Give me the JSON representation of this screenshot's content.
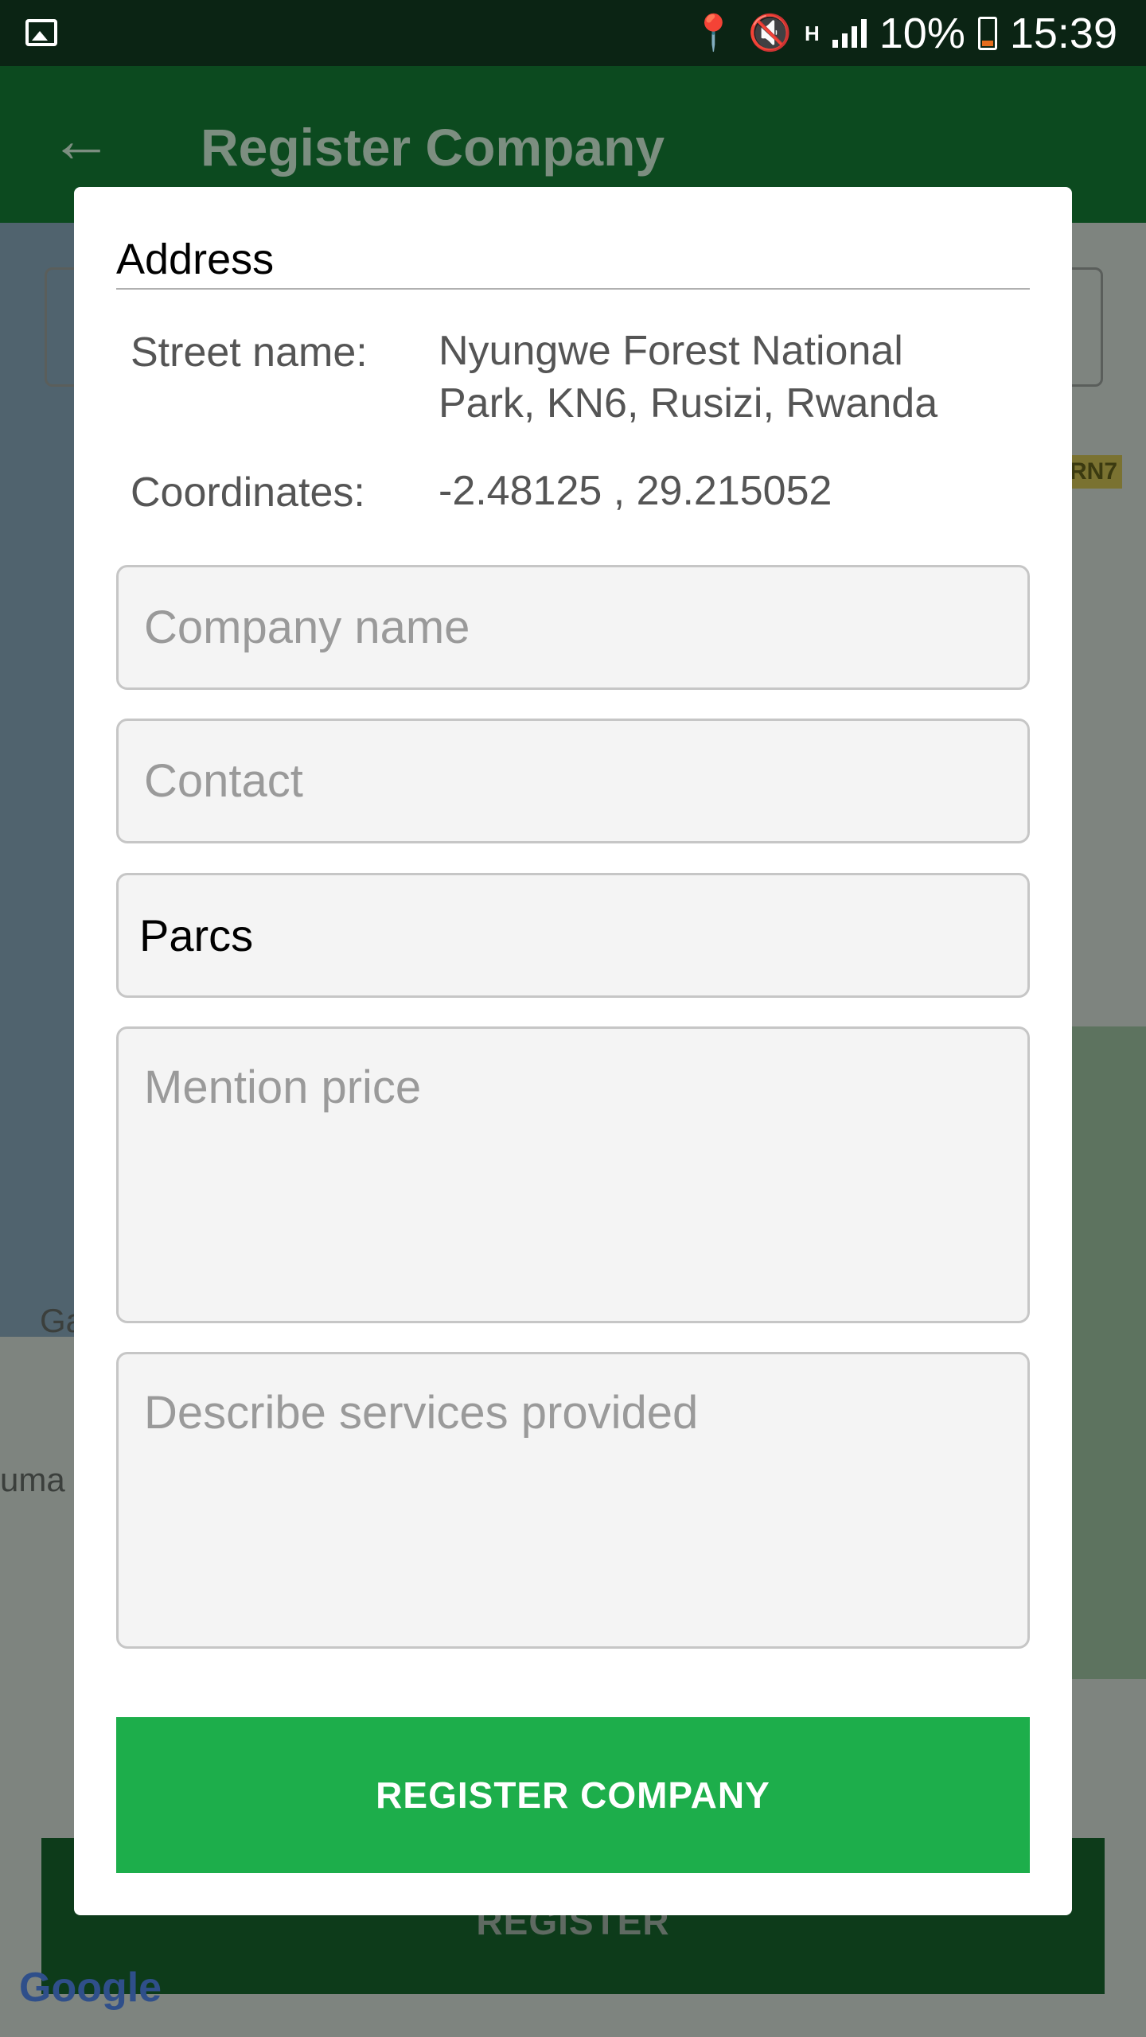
{
  "status_bar": {
    "battery": "10%",
    "time": "15:39",
    "network_type": "H",
    "icons": [
      "image-icon",
      "location-pin-icon",
      "vibrate-icon",
      "signal-icon",
      "battery-icon"
    ]
  },
  "app_bar": {
    "title": "Register Company",
    "back_icon": "arrow-back-icon"
  },
  "background": {
    "register_button_label": "REGISTER",
    "road_tag": "RN7",
    "map_labels": [
      "Ga",
      "uma"
    ],
    "map_logo": "Google"
  },
  "dialog": {
    "section_title": "Address",
    "street_label": "Street name:",
    "street_value": "Nyungwe Forest National Park, KN6, Rusizi, Rwanda",
    "coordinates_label": "Coordinates:",
    "coordinates_value": "-2.48125 , 29.215052",
    "company_name_placeholder": "Company name",
    "contact_placeholder": "Contact",
    "category_selected": "Parcs",
    "price_placeholder": "Mention price",
    "services_placeholder": "Describe services provided",
    "register_button_label": "REGISTER COMPANY"
  },
  "colors": {
    "status_bar": "#0b2414",
    "app_bar": "#0c4a1f",
    "primary_button": "#1dae4b",
    "battery_low": "#e46c1d"
  }
}
